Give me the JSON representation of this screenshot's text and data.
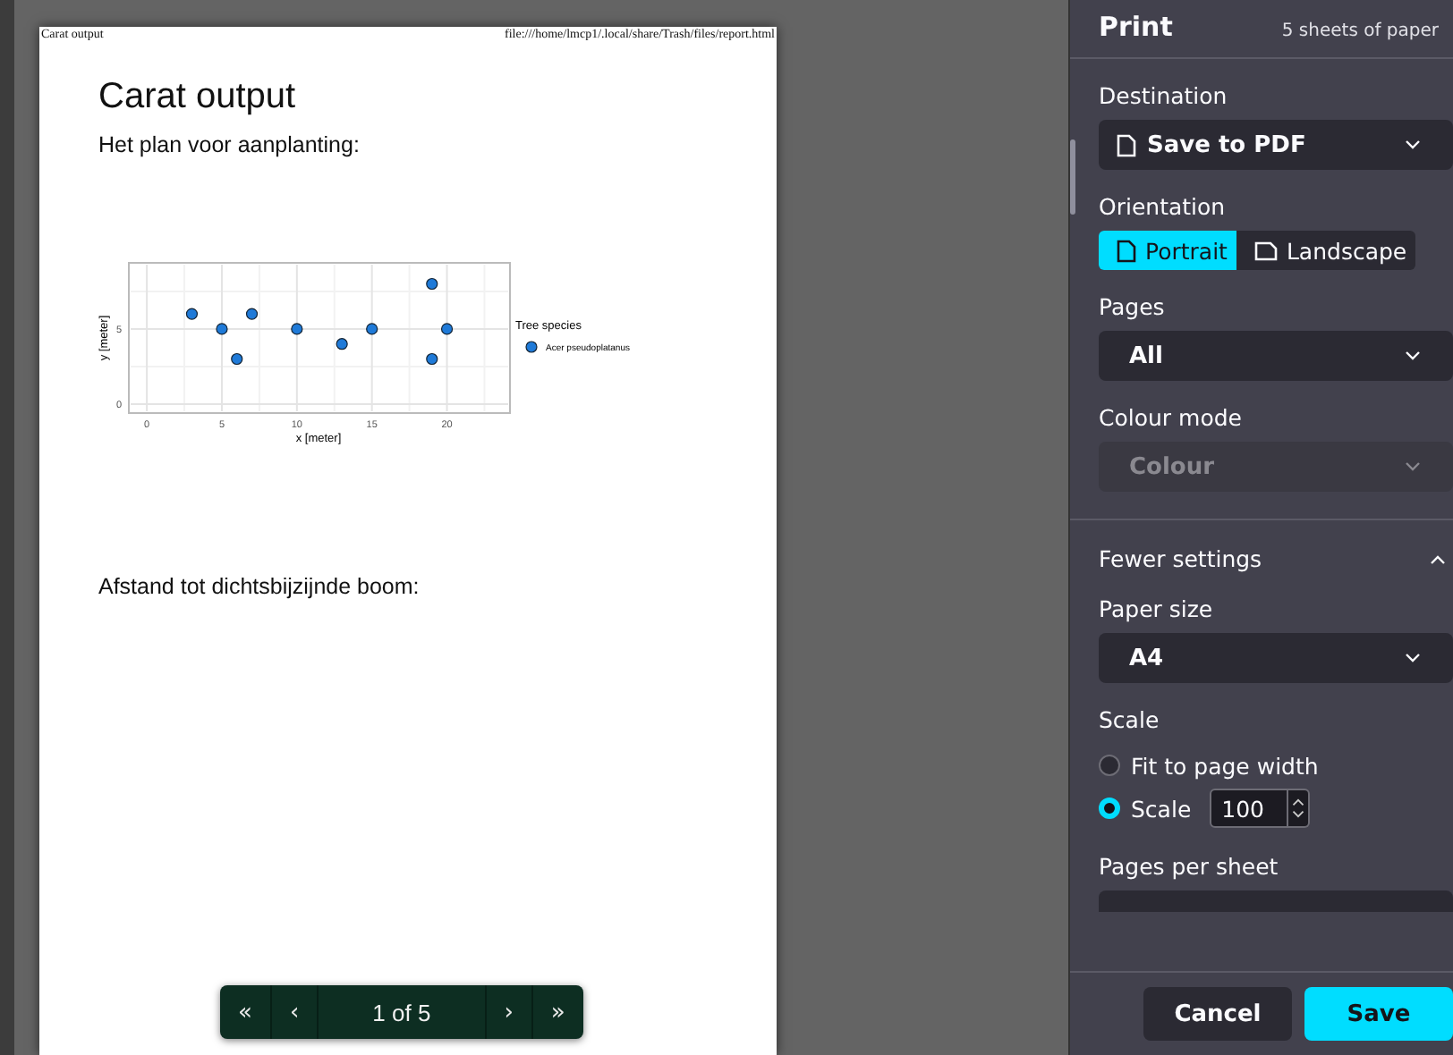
{
  "preview": {
    "page": {
      "header_title": "Carat output",
      "header_url": "file:///home/lmcp1/.local/share/Trash/files/report.html",
      "title": "Carat output",
      "intro": "Het plan voor aanplanting:",
      "chart_data": {
        "type": "scatter",
        "xlabel": "x [meter]",
        "ylabel": "y [meter]",
        "xticks": [
          0,
          5,
          10,
          15,
          20
        ],
        "yticks": [
          0,
          5
        ],
        "xlim": [
          -1.2,
          24.2
        ],
        "ylim": [
          -0.6,
          9.4
        ],
        "grid": true,
        "legend_title": "Tree species",
        "series": [
          {
            "name": "Acer pseudoplatanus",
            "color": "#1f7ad8",
            "x": [
              3,
              5,
              6,
              7,
              10,
              13,
              15,
              19,
              19,
              20
            ],
            "values": [
              6,
              5,
              3,
              6,
              5,
              4,
              5,
              8,
              3,
              5
            ]
          }
        ]
      },
      "section": "Afstand tot dichtsbijzijnde boom:"
    },
    "pager": {
      "first": "«",
      "prev": "‹",
      "status": "1 of 5",
      "next": "›",
      "last": "»"
    }
  },
  "panel": {
    "title": "Print",
    "sheets": "5 sheets of paper",
    "destination": {
      "label": "Destination",
      "value": "Save to PDF"
    },
    "orientation": {
      "label": "Orientation",
      "options": [
        {
          "label": "Portrait",
          "selected": true
        },
        {
          "label": "Landscape",
          "selected": false
        }
      ]
    },
    "pages": {
      "label": "Pages",
      "value": "All"
    },
    "colour_mode": {
      "label": "Colour mode",
      "value": "Colour",
      "disabled": true
    },
    "more_settings": {
      "label": "Fewer settings",
      "expanded": true
    },
    "paper_size": {
      "label": "Paper size",
      "value": "A4"
    },
    "scale": {
      "label": "Scale",
      "options": [
        {
          "label": "Fit to page width",
          "selected": false
        },
        {
          "label": "Scale",
          "selected": true
        }
      ],
      "value": "100"
    },
    "pages_per_sheet": {
      "label": "Pages per sheet"
    },
    "buttons": [
      {
        "label": "Cancel",
        "kind": "secondary"
      },
      {
        "label": "Save",
        "kind": "primary"
      }
    ]
  }
}
